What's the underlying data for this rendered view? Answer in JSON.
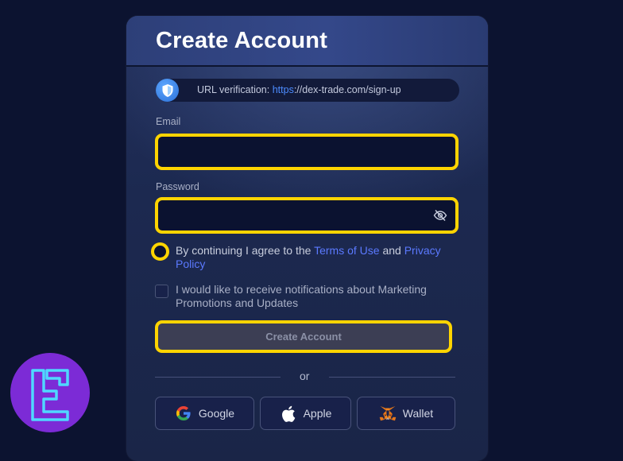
{
  "header": {
    "title": "Create Account"
  },
  "url_verification": {
    "label": "URL verification: ",
    "scheme": "https",
    "rest": "://dex-trade.com/sign-up"
  },
  "form": {
    "email_label": "Email",
    "email_value": "",
    "password_label": "Password",
    "password_value": ""
  },
  "agreement": {
    "prefix": "By continuing I agree to the ",
    "terms_link": "Terms of Use",
    "and": " and ",
    "privacy_link": "Privacy Policy"
  },
  "notifications": {
    "label": "I would like to receive notifications about Marketing Promotions and Updates",
    "checked": false
  },
  "create_button": "Create Account",
  "divider_text": "or",
  "social": {
    "google": "Google",
    "apple": "Apple",
    "wallet": "Wallet"
  },
  "colors": {
    "highlight": "#ffd400",
    "link": "#5b79ff",
    "background": "#0c1330",
    "logo_bg": "#7c2bd6",
    "logo_stroke": "#4fd8ff"
  }
}
